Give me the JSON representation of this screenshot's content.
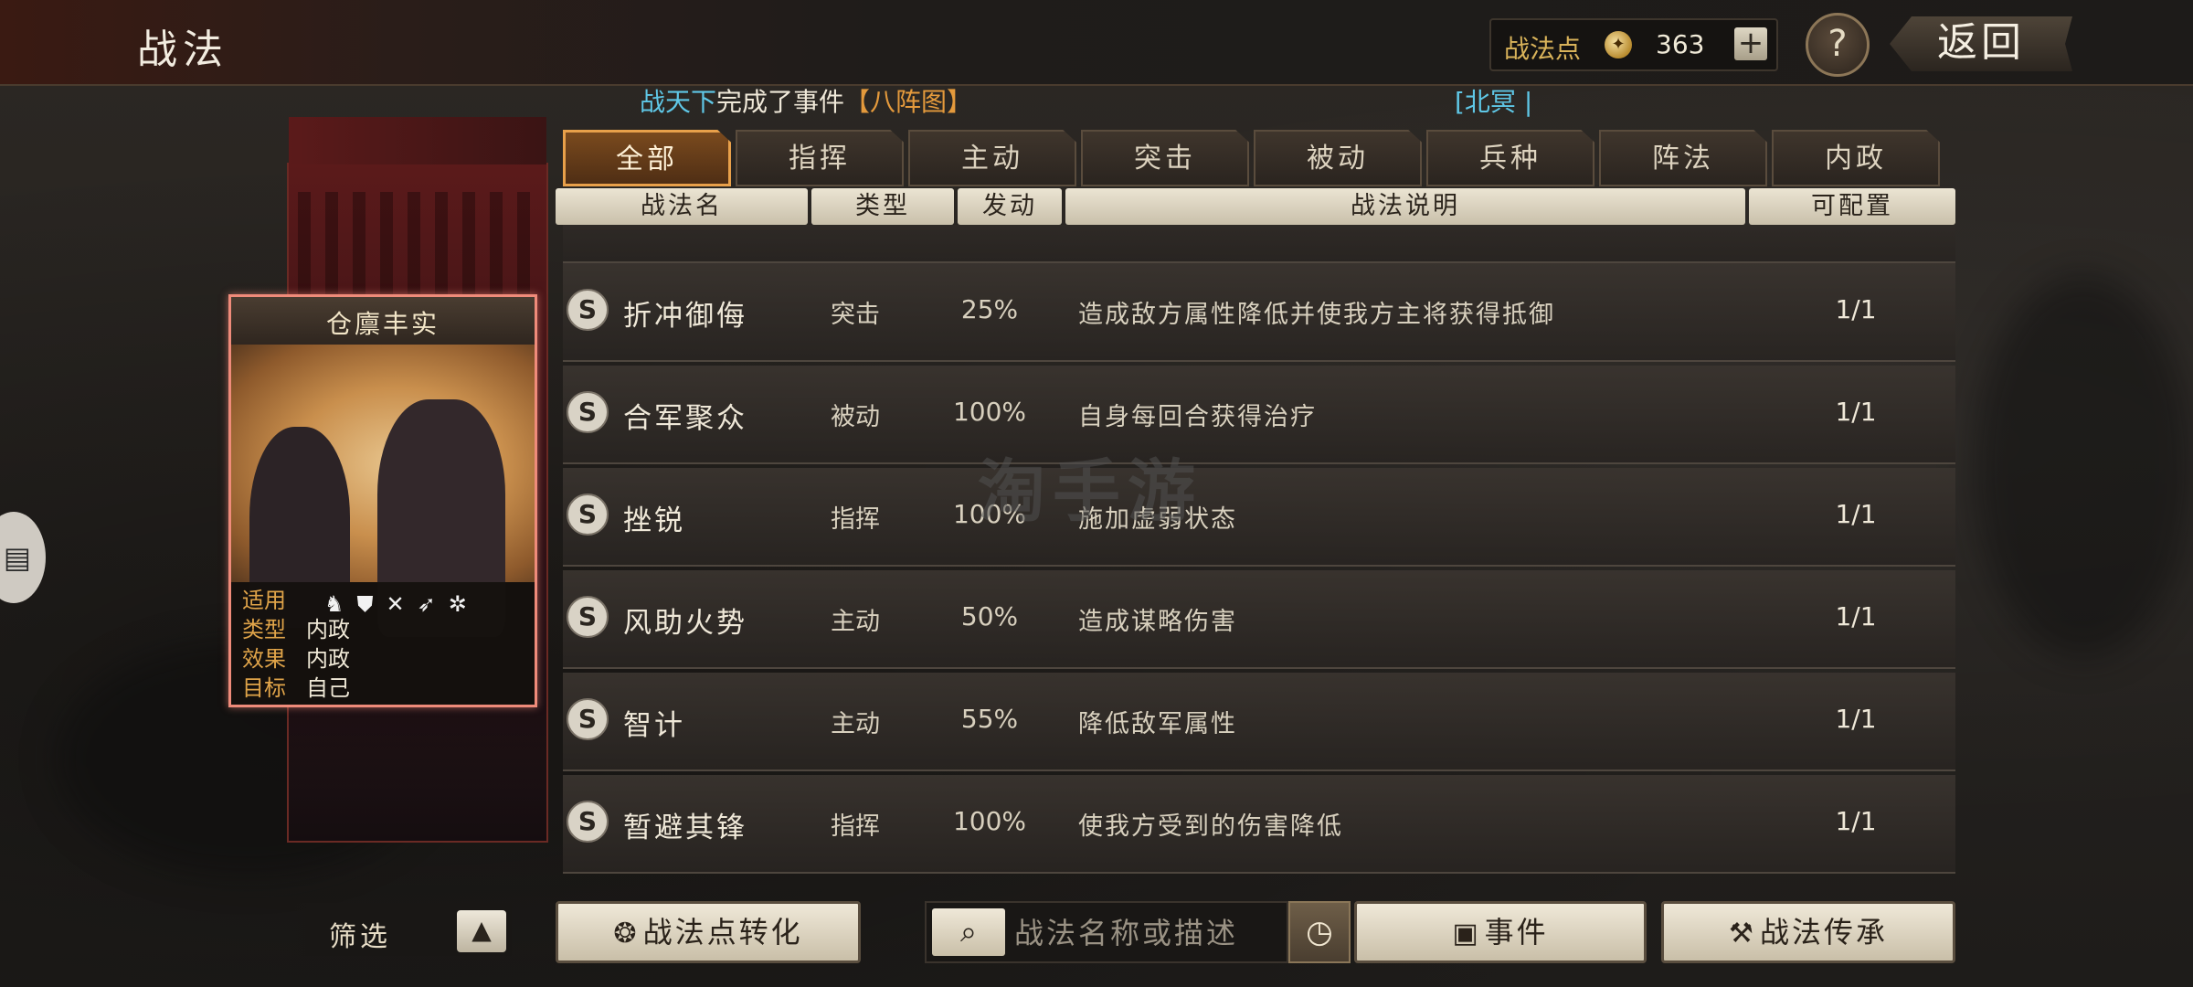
{
  "header": {
    "title": "战法",
    "points_label": "战法点",
    "points_value": "363",
    "plus_label": "+",
    "help_label": "?",
    "back_label": "返回"
  },
  "ticker": {
    "player": "战天下",
    "text": "完成了事件",
    "event": "【八阵图】",
    "right": "[北冥 |"
  },
  "card": {
    "name": "仓廪丰实",
    "rows": [
      {
        "key": "适用",
        "value": ""
      },
      {
        "key": "类型",
        "value": "内政"
      },
      {
        "key": "效果",
        "value": "内政"
      },
      {
        "key": "目标",
        "value": "自己"
      }
    ],
    "unit_icons": [
      "cavalry-icon",
      "shield-icon",
      "archer-icon",
      "spear-icon",
      "siege-icon"
    ]
  },
  "tabs": [
    "全部",
    "指挥",
    "主动",
    "突击",
    "被动",
    "兵种",
    "阵法",
    "内政"
  ],
  "active_tab": 0,
  "columns": [
    "战法名",
    "类型",
    "发动",
    "战法说明",
    "可配置"
  ],
  "skills": [
    {
      "grade": "S",
      "name": "折冲御侮",
      "type": "突击",
      "rate": "25%",
      "desc": "造成敌方属性降低并使我方主将获得抵御",
      "config": "1/1"
    },
    {
      "grade": "S",
      "name": "合军聚众",
      "type": "被动",
      "rate": "100%",
      "desc": "自身每回合获得治疗",
      "config": "1/1"
    },
    {
      "grade": "S",
      "name": "挫锐",
      "type": "指挥",
      "rate": "100%",
      "desc": "施加虚弱状态",
      "config": "1/1"
    },
    {
      "grade": "S",
      "name": "风助火势",
      "type": "主动",
      "rate": "50%",
      "desc": "造成谋略伤害",
      "config": "1/1"
    },
    {
      "grade": "S",
      "name": "智计",
      "type": "主动",
      "rate": "55%",
      "desc": "降低敌军属性",
      "config": "1/1"
    },
    {
      "grade": "S",
      "name": "暂避其锋",
      "type": "指挥",
      "rate": "100%",
      "desc": "使我方受到的伤害降低",
      "config": "1/1"
    }
  ],
  "watermark": "淘手游",
  "bottom": {
    "filter_label": "筛选",
    "filter_arrow": "▲",
    "convert_label": "战法点转化",
    "search_placeholder": "战法名称或描述",
    "event_label": "事件",
    "inherit_label": "战法传承"
  }
}
